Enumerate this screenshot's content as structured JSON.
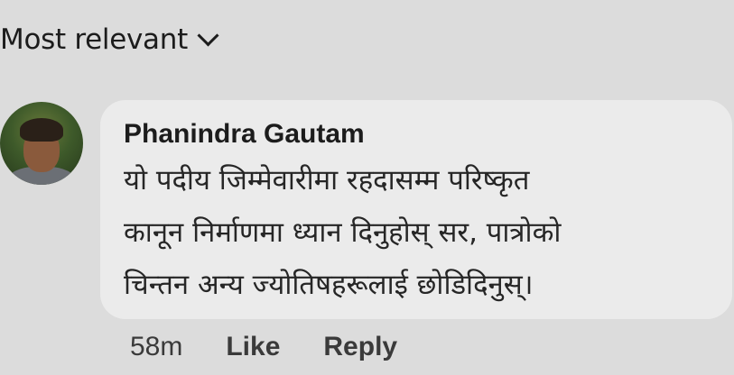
{
  "sort": {
    "label": "Most relevant",
    "icon": "chevron-down-icon"
  },
  "comment": {
    "author": "Phanindra Gautam",
    "lines": [
      "यो पदीय जिम्मेवारीमा रहदासम्म परिष्कृत",
      "कानून निर्माणमा ध्यान दिनुहोस् सर, पात्रोको",
      "चिन्तन अन्य ज्योतिषहरूलाई छोडिदिनुस्।"
    ],
    "time": "58m",
    "like_label": "Like",
    "reply_label": "Reply"
  },
  "colors": {
    "page_background": "#dcdcdc",
    "bubble_background": "#ebebeb",
    "text": "#1c1c1c"
  }
}
